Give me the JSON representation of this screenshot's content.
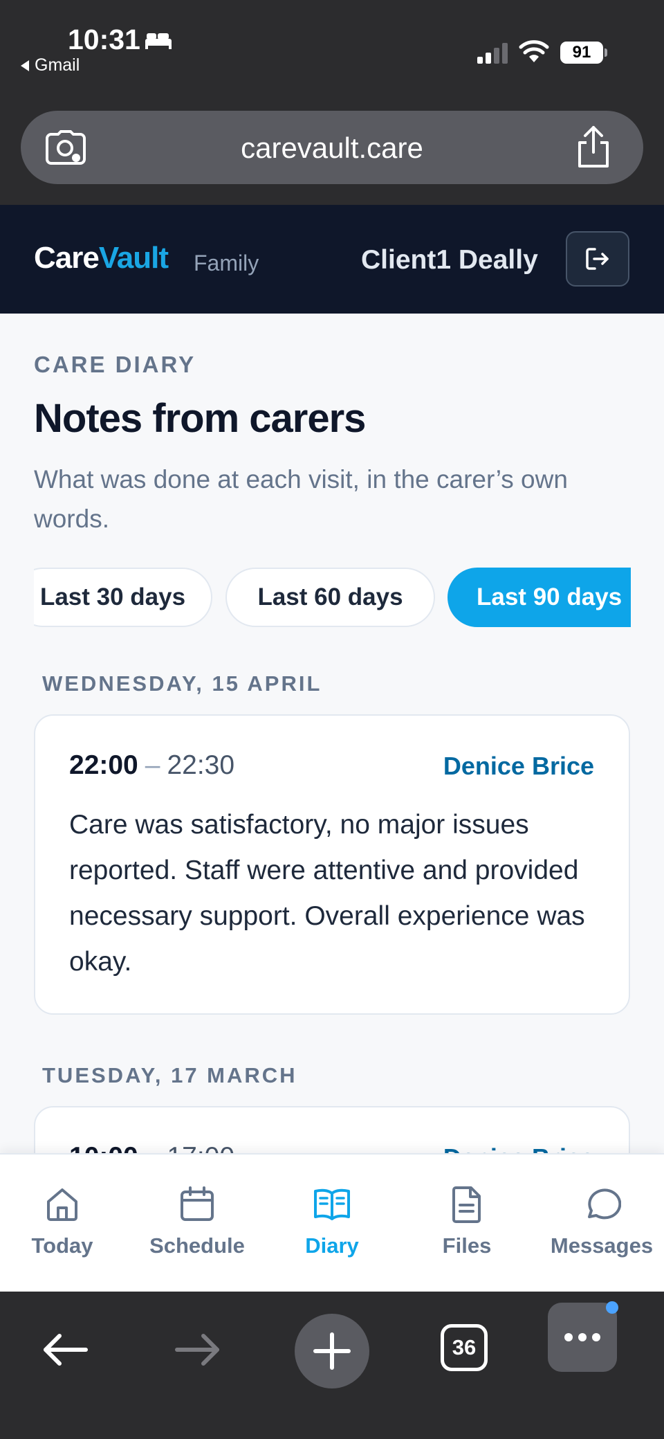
{
  "status_bar": {
    "time": "10:31",
    "back_app": "Gmail",
    "battery": "91"
  },
  "browser": {
    "url": "carevault.care",
    "tabs_count": "36"
  },
  "header": {
    "brand_care": "Care",
    "brand_vault": "Vault",
    "brand_sub": "Family",
    "client_name": "Client1 Deally"
  },
  "page": {
    "eyebrow": "CARE DIARY",
    "title": "Notes from carers",
    "subtitle": "What was done at each visit, in the carer’s own words."
  },
  "filters": [
    {
      "label": "Last 30 days",
      "active": false
    },
    {
      "label": "Last 60 days",
      "active": false
    },
    {
      "label": "Last 90 days",
      "active": true
    }
  ],
  "entries": [
    {
      "day": "WEDNESDAY, 15 APRIL",
      "start": "22:00",
      "end": "22:30",
      "carer": "Denice Brice",
      "note": "Care was satisfactory, no major issues reported. Staff were attentive and provided necessary support. Overall experience was okay."
    },
    {
      "day": "TUESDAY, 17 MARCH",
      "start": "10:00",
      "end": "17:00",
      "carer": "Denice Brice",
      "note": ""
    }
  ],
  "tabs": [
    {
      "label": "Today",
      "icon": "home-icon",
      "active": false
    },
    {
      "label": "Schedule",
      "icon": "calendar-icon",
      "active": false
    },
    {
      "label": "Diary",
      "icon": "book-icon",
      "active": true
    },
    {
      "label": "Files",
      "icon": "document-icon",
      "active": false
    },
    {
      "label": "Messages",
      "icon": "chat-icon",
      "active": false
    }
  ],
  "colors": {
    "header_bg": "#0f172a",
    "accent": "#0ea5e9",
    "carer_link": "#0369a1",
    "page_bg": "#f7f8fa"
  }
}
